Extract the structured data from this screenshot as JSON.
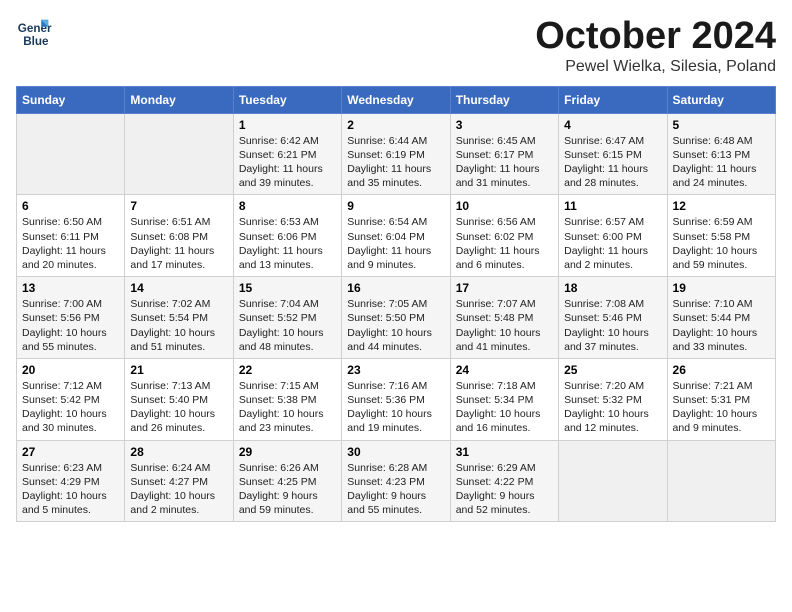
{
  "header": {
    "logo_line1": "General",
    "logo_line2": "Blue",
    "title": "October 2024",
    "subtitle": "Pewel Wielka, Silesia, Poland"
  },
  "weekdays": [
    "Sunday",
    "Monday",
    "Tuesday",
    "Wednesday",
    "Thursday",
    "Friday",
    "Saturday"
  ],
  "weeks": [
    [
      {
        "day": "",
        "sunrise": "",
        "sunset": "",
        "daylight": "",
        "empty": true
      },
      {
        "day": "",
        "sunrise": "",
        "sunset": "",
        "daylight": "",
        "empty": true
      },
      {
        "day": "1",
        "sunrise": "Sunrise: 6:42 AM",
        "sunset": "Sunset: 6:21 PM",
        "daylight": "Daylight: 11 hours and 39 minutes."
      },
      {
        "day": "2",
        "sunrise": "Sunrise: 6:44 AM",
        "sunset": "Sunset: 6:19 PM",
        "daylight": "Daylight: 11 hours and 35 minutes."
      },
      {
        "day": "3",
        "sunrise": "Sunrise: 6:45 AM",
        "sunset": "Sunset: 6:17 PM",
        "daylight": "Daylight: 11 hours and 31 minutes."
      },
      {
        "day": "4",
        "sunrise": "Sunrise: 6:47 AM",
        "sunset": "Sunset: 6:15 PM",
        "daylight": "Daylight: 11 hours and 28 minutes."
      },
      {
        "day": "5",
        "sunrise": "Sunrise: 6:48 AM",
        "sunset": "Sunset: 6:13 PM",
        "daylight": "Daylight: 11 hours and 24 minutes."
      }
    ],
    [
      {
        "day": "6",
        "sunrise": "Sunrise: 6:50 AM",
        "sunset": "Sunset: 6:11 PM",
        "daylight": "Daylight: 11 hours and 20 minutes."
      },
      {
        "day": "7",
        "sunrise": "Sunrise: 6:51 AM",
        "sunset": "Sunset: 6:08 PM",
        "daylight": "Daylight: 11 hours and 17 minutes."
      },
      {
        "day": "8",
        "sunrise": "Sunrise: 6:53 AM",
        "sunset": "Sunset: 6:06 PM",
        "daylight": "Daylight: 11 hours and 13 minutes."
      },
      {
        "day": "9",
        "sunrise": "Sunrise: 6:54 AM",
        "sunset": "Sunset: 6:04 PM",
        "daylight": "Daylight: 11 hours and 9 minutes."
      },
      {
        "day": "10",
        "sunrise": "Sunrise: 6:56 AM",
        "sunset": "Sunset: 6:02 PM",
        "daylight": "Daylight: 11 hours and 6 minutes."
      },
      {
        "day": "11",
        "sunrise": "Sunrise: 6:57 AM",
        "sunset": "Sunset: 6:00 PM",
        "daylight": "Daylight: 11 hours and 2 minutes."
      },
      {
        "day": "12",
        "sunrise": "Sunrise: 6:59 AM",
        "sunset": "Sunset: 5:58 PM",
        "daylight": "Daylight: 10 hours and 59 minutes."
      }
    ],
    [
      {
        "day": "13",
        "sunrise": "Sunrise: 7:00 AM",
        "sunset": "Sunset: 5:56 PM",
        "daylight": "Daylight: 10 hours and 55 minutes."
      },
      {
        "day": "14",
        "sunrise": "Sunrise: 7:02 AM",
        "sunset": "Sunset: 5:54 PM",
        "daylight": "Daylight: 10 hours and 51 minutes."
      },
      {
        "day": "15",
        "sunrise": "Sunrise: 7:04 AM",
        "sunset": "Sunset: 5:52 PM",
        "daylight": "Daylight: 10 hours and 48 minutes."
      },
      {
        "day": "16",
        "sunrise": "Sunrise: 7:05 AM",
        "sunset": "Sunset: 5:50 PM",
        "daylight": "Daylight: 10 hours and 44 minutes."
      },
      {
        "day": "17",
        "sunrise": "Sunrise: 7:07 AM",
        "sunset": "Sunset: 5:48 PM",
        "daylight": "Daylight: 10 hours and 41 minutes."
      },
      {
        "day": "18",
        "sunrise": "Sunrise: 7:08 AM",
        "sunset": "Sunset: 5:46 PM",
        "daylight": "Daylight: 10 hours and 37 minutes."
      },
      {
        "day": "19",
        "sunrise": "Sunrise: 7:10 AM",
        "sunset": "Sunset: 5:44 PM",
        "daylight": "Daylight: 10 hours and 33 minutes."
      }
    ],
    [
      {
        "day": "20",
        "sunrise": "Sunrise: 7:12 AM",
        "sunset": "Sunset: 5:42 PM",
        "daylight": "Daylight: 10 hours and 30 minutes."
      },
      {
        "day": "21",
        "sunrise": "Sunrise: 7:13 AM",
        "sunset": "Sunset: 5:40 PM",
        "daylight": "Daylight: 10 hours and 26 minutes."
      },
      {
        "day": "22",
        "sunrise": "Sunrise: 7:15 AM",
        "sunset": "Sunset: 5:38 PM",
        "daylight": "Daylight: 10 hours and 23 minutes."
      },
      {
        "day": "23",
        "sunrise": "Sunrise: 7:16 AM",
        "sunset": "Sunset: 5:36 PM",
        "daylight": "Daylight: 10 hours and 19 minutes."
      },
      {
        "day": "24",
        "sunrise": "Sunrise: 7:18 AM",
        "sunset": "Sunset: 5:34 PM",
        "daylight": "Daylight: 10 hours and 16 minutes."
      },
      {
        "day": "25",
        "sunrise": "Sunrise: 7:20 AM",
        "sunset": "Sunset: 5:32 PM",
        "daylight": "Daylight: 10 hours and 12 minutes."
      },
      {
        "day": "26",
        "sunrise": "Sunrise: 7:21 AM",
        "sunset": "Sunset: 5:31 PM",
        "daylight": "Daylight: 10 hours and 9 minutes."
      }
    ],
    [
      {
        "day": "27",
        "sunrise": "Sunrise: 6:23 AM",
        "sunset": "Sunset: 4:29 PM",
        "daylight": "Daylight: 10 hours and 5 minutes."
      },
      {
        "day": "28",
        "sunrise": "Sunrise: 6:24 AM",
        "sunset": "Sunset: 4:27 PM",
        "daylight": "Daylight: 10 hours and 2 minutes."
      },
      {
        "day": "29",
        "sunrise": "Sunrise: 6:26 AM",
        "sunset": "Sunset: 4:25 PM",
        "daylight": "Daylight: 9 hours and 59 minutes."
      },
      {
        "day": "30",
        "sunrise": "Sunrise: 6:28 AM",
        "sunset": "Sunset: 4:23 PM",
        "daylight": "Daylight: 9 hours and 55 minutes."
      },
      {
        "day": "31",
        "sunrise": "Sunrise: 6:29 AM",
        "sunset": "Sunset: 4:22 PM",
        "daylight": "Daylight: 9 hours and 52 minutes."
      },
      {
        "day": "",
        "sunrise": "",
        "sunset": "",
        "daylight": "",
        "empty": true
      },
      {
        "day": "",
        "sunrise": "",
        "sunset": "",
        "daylight": "",
        "empty": true
      }
    ]
  ]
}
